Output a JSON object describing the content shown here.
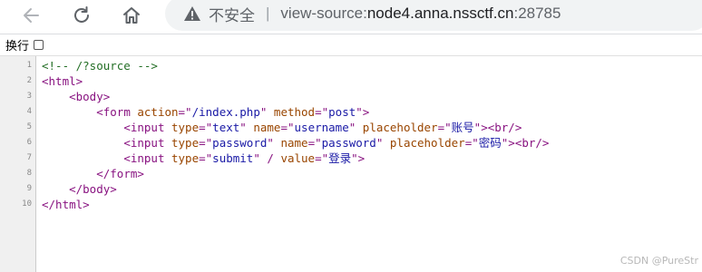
{
  "browser": {
    "back_icon": "arrow-left-icon",
    "reload_icon": "reload-icon",
    "home_icon": "home-icon",
    "security_icon": "warning-triangle-icon",
    "security_label": "不安全",
    "separator": "|",
    "url_prefix": "view-source:",
    "url_host": "node4.anna.nssctf.cn",
    "url_port": ":28785"
  },
  "wrap": {
    "label": "换行",
    "checked": false
  },
  "source": {
    "line_numbers": [
      "1",
      "2",
      "3",
      "4",
      "5",
      "6",
      "7",
      "8",
      "9",
      "10"
    ],
    "lines": [
      [
        {
          "t": "comment",
          "v": "<!-- /?source -->"
        }
      ],
      [
        {
          "t": "tag",
          "v": "<html>"
        }
      ],
      [
        {
          "t": "text",
          "v": "    "
        },
        {
          "t": "tag",
          "v": "<body>"
        }
      ],
      [
        {
          "t": "text",
          "v": "        "
        },
        {
          "t": "tag",
          "v": "<form "
        },
        {
          "t": "attr",
          "v": "action"
        },
        {
          "t": "tag",
          "v": "=\""
        },
        {
          "t": "val",
          "v": "/index.php"
        },
        {
          "t": "tag",
          "v": "\" "
        },
        {
          "t": "attr",
          "v": "method"
        },
        {
          "t": "tag",
          "v": "=\""
        },
        {
          "t": "val",
          "v": "post"
        },
        {
          "t": "tag",
          "v": "\">"
        }
      ],
      [
        {
          "t": "text",
          "v": "            "
        },
        {
          "t": "tag",
          "v": "<input "
        },
        {
          "t": "attr",
          "v": "type"
        },
        {
          "t": "tag",
          "v": "=\""
        },
        {
          "t": "val",
          "v": "text"
        },
        {
          "t": "tag",
          "v": "\" "
        },
        {
          "t": "attr",
          "v": "name"
        },
        {
          "t": "tag",
          "v": "=\""
        },
        {
          "t": "val",
          "v": "username"
        },
        {
          "t": "tag",
          "v": "\" "
        },
        {
          "t": "attr",
          "v": "placeholder"
        },
        {
          "t": "tag",
          "v": "=\""
        },
        {
          "t": "val",
          "v": "账号"
        },
        {
          "t": "tag",
          "v": "\"><br/>"
        }
      ],
      [
        {
          "t": "text",
          "v": "            "
        },
        {
          "t": "tag",
          "v": "<input "
        },
        {
          "t": "attr",
          "v": "type"
        },
        {
          "t": "tag",
          "v": "=\""
        },
        {
          "t": "val",
          "v": "password"
        },
        {
          "t": "tag",
          "v": "\" "
        },
        {
          "t": "attr",
          "v": "name"
        },
        {
          "t": "tag",
          "v": "=\""
        },
        {
          "t": "val",
          "v": "password"
        },
        {
          "t": "tag",
          "v": "\" "
        },
        {
          "t": "attr",
          "v": "placeholder"
        },
        {
          "t": "tag",
          "v": "=\""
        },
        {
          "t": "val",
          "v": "密码"
        },
        {
          "t": "tag",
          "v": "\"><br/>"
        }
      ],
      [
        {
          "t": "text",
          "v": "            "
        },
        {
          "t": "tag",
          "v": "<input "
        },
        {
          "t": "attr",
          "v": "type"
        },
        {
          "t": "tag",
          "v": "=\""
        },
        {
          "t": "val",
          "v": "submit"
        },
        {
          "t": "tag",
          "v": "\" / "
        },
        {
          "t": "attr",
          "v": "value"
        },
        {
          "t": "tag",
          "v": "=\""
        },
        {
          "t": "val",
          "v": "登录"
        },
        {
          "t": "tag",
          "v": "\">"
        }
      ],
      [
        {
          "t": "text",
          "v": "        "
        },
        {
          "t": "tag",
          "v": "</form>"
        }
      ],
      [
        {
          "t": "text",
          "v": "    "
        },
        {
          "t": "tag",
          "v": "</body>"
        }
      ],
      [
        {
          "t": "tag",
          "v": "</html>"
        }
      ]
    ]
  },
  "watermark": "CSDN @PureStr",
  "colors": {
    "comment": "#236e25",
    "tag": "#881280",
    "attr": "#994500",
    "value": "#1a1aa6",
    "gutter_bg": "#f0f0f0"
  }
}
